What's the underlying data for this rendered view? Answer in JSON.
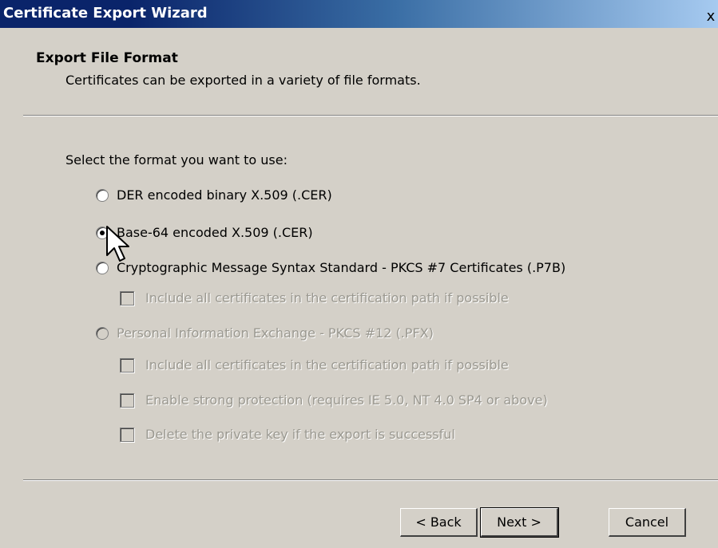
{
  "window": {
    "title": "Certificate Export Wizard",
    "close_label": "x"
  },
  "header": {
    "title": "Export File Format",
    "subtitle": "Certificates can be exported in a variety of file formats."
  },
  "prompt": "Select the format you want to use:",
  "formats": [
    {
      "label": "DER encoded binary X.509 (.CER)",
      "selected": false,
      "enabled": true
    },
    {
      "label": "Base-64 encoded X.509 (.CER)",
      "selected": true,
      "enabled": true
    },
    {
      "label": "Cryptographic Message Syntax Standard - PKCS #7 Certificates (.P7B)",
      "selected": false,
      "enabled": true
    },
    {
      "label": "Personal Information Exchange - PKCS #12 (.PFX)",
      "selected": false,
      "enabled": false
    }
  ],
  "p7b_options": [
    {
      "label": "Include all certificates in the certification path if possible",
      "checked": false,
      "enabled": false
    }
  ],
  "pfx_options": [
    {
      "label": "Include all certificates in the certification path if possible",
      "checked": false,
      "enabled": false
    },
    {
      "label": "Enable strong protection (requires IE 5.0, NT 4.0 SP4 or above)",
      "checked": false,
      "enabled": false
    },
    {
      "label": "Delete the private key if the export is successful",
      "checked": false,
      "enabled": false
    }
  ],
  "buttons": {
    "back": "< Back",
    "next": "Next >",
    "cancel": "Cancel"
  },
  "colors": {
    "titlebar_start": "#0a246a",
    "titlebar_end": "#a6caf0",
    "dialog_face": "#d4d0c8",
    "disabled_text": "#9a9890"
  }
}
